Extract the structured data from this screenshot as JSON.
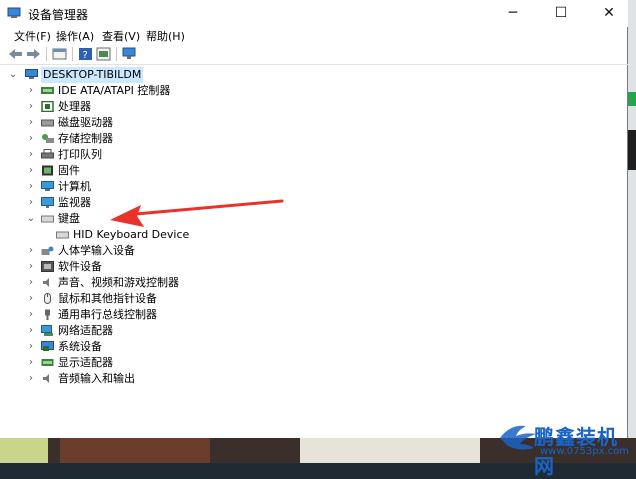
{
  "window": {
    "title": "设备管理器"
  },
  "controls": {
    "minimize": "─",
    "maximize": "☐",
    "close": "✕"
  },
  "menu": [
    "文件(F)",
    "操作(A)",
    "查看(V)",
    "帮助(H)"
  ],
  "tree": {
    "root": "DESKTOP-TIBILDM",
    "items": [
      {
        "label": "IDE ATA/ATAPI 控制器",
        "icon": "ide-controller-icon",
        "expanded": false
      },
      {
        "label": "处理器",
        "icon": "processor-icon",
        "expanded": false
      },
      {
        "label": "磁盘驱动器",
        "icon": "disk-drive-icon",
        "expanded": false
      },
      {
        "label": "存储控制器",
        "icon": "storage-controller-icon",
        "expanded": false
      },
      {
        "label": "打印队列",
        "icon": "printer-icon",
        "expanded": false
      },
      {
        "label": "固件",
        "icon": "firmware-icon",
        "expanded": false
      },
      {
        "label": "计算机",
        "icon": "computer-icon",
        "expanded": false
      },
      {
        "label": "监视器",
        "icon": "monitor-icon",
        "expanded": false
      },
      {
        "label": "键盘",
        "icon": "keyboard-icon",
        "expanded": true,
        "children": [
          "HID Keyboard Device"
        ]
      },
      {
        "label": "人体学输入设备",
        "icon": "hid-icon",
        "expanded": false
      },
      {
        "label": "软件设备",
        "icon": "software-device-icon",
        "expanded": false
      },
      {
        "label": "声音、视频和游戏控制器",
        "icon": "sound-icon",
        "expanded": false
      },
      {
        "label": "鼠标和其他指针设备",
        "icon": "mouse-icon",
        "expanded": false
      },
      {
        "label": "通用串行总线控制器",
        "icon": "usb-icon",
        "expanded": false
      },
      {
        "label": "网络适配器",
        "icon": "network-icon",
        "expanded": false
      },
      {
        "label": "系统设备",
        "icon": "system-device-icon",
        "expanded": false
      },
      {
        "label": "显示适配器",
        "icon": "display-adapter-icon",
        "expanded": false
      },
      {
        "label": "音频输入和输出",
        "icon": "audio-io-icon",
        "expanded": false
      }
    ]
  },
  "watermark": {
    "text": "鹏鑫装机网",
    "url": "www.0753px.com"
  },
  "colors": {
    "selection": "#cce8ff",
    "arrow": "#e8322a",
    "watermark": "#1a63c7"
  }
}
